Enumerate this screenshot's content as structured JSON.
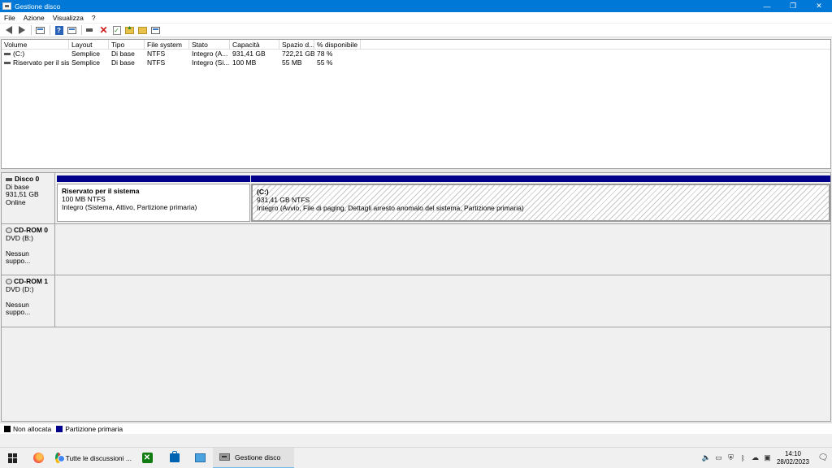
{
  "window": {
    "title": "Gestione disco",
    "icons": [
      "disk-management-icon",
      "minimize-icon",
      "maximize-icon",
      "close-icon"
    ],
    "controls": {
      "minimize": "—",
      "maximize": "❐",
      "close": "✕"
    }
  },
  "menu": [
    "File",
    "Azione",
    "Visualizza",
    "?"
  ],
  "toolbar": {
    "icons": [
      "back-arrow-icon",
      "forward-arrow-icon",
      "console-tree-icon",
      "help-icon",
      "properties-icon",
      "connect-disk-icon",
      "delete-icon",
      "check-icon",
      "open-folder-icon",
      "explore-icon",
      "rescan-icon"
    ]
  },
  "volumes": {
    "columns": [
      "Volume",
      "Layout",
      "Tipo",
      "File system",
      "Stato",
      "Capacità",
      "Spazio d...",
      "% disponibile"
    ],
    "rows": [
      [
        "(C:)",
        "Semplice",
        "Di base",
        "NTFS",
        "Integro (A...",
        "931,41 GB",
        "722,21 GB",
        "78 %"
      ],
      [
        "Riservato per il sist...",
        "Semplice",
        "Di base",
        "NTFS",
        "Integro (Si...",
        "100 MB",
        "55 MB",
        "55 %"
      ]
    ]
  },
  "disks": [
    {
      "name": "Disco 0",
      "type": "Di base",
      "size": "931,51 GB",
      "status": "Online",
      "partitions": [
        {
          "name": "Riservato per il sistema",
          "size": "100 MB NTFS",
          "status": "Integro (Sistema, Attivo, Partizione primaria)"
        },
        {
          "name": "(C:)",
          "size": "931,41 GB NTFS",
          "status": "Integro (Avvio, File di paging, Dettagli arresto anomalo del sistema, Partizione primaria)"
        }
      ]
    },
    {
      "name": "CD-ROM 0",
      "type": "DVD (B:)",
      "status": "Nessun suppo..."
    },
    {
      "name": "CD-ROM 1",
      "type": "DVD (D:)",
      "status": "Nessun suppo..."
    }
  ],
  "legend": [
    {
      "label": "Non allocata",
      "color": "#000000"
    },
    {
      "label": "Partizione primaria",
      "color": "#00008b"
    }
  ],
  "taskbar": {
    "items": [
      {
        "icon": "windows-start-icon"
      },
      {
        "icon": "firefox-icon"
      },
      {
        "icon": "chrome-icon",
        "label": "Tutte le discussioni ..."
      },
      {
        "icon": "xbox-icon"
      },
      {
        "icon": "store-icon"
      },
      {
        "icon": "photos-icon"
      },
      {
        "icon": "disk-management-icon",
        "label": "Gestione disco",
        "active": true
      }
    ],
    "tray_icons": [
      "volume-icon",
      "network-icon",
      "security-icon",
      "bluetooth-icon",
      "onedrive-icon",
      "wifi-icon"
    ],
    "time": "14:10",
    "date": "28/02/2023"
  }
}
